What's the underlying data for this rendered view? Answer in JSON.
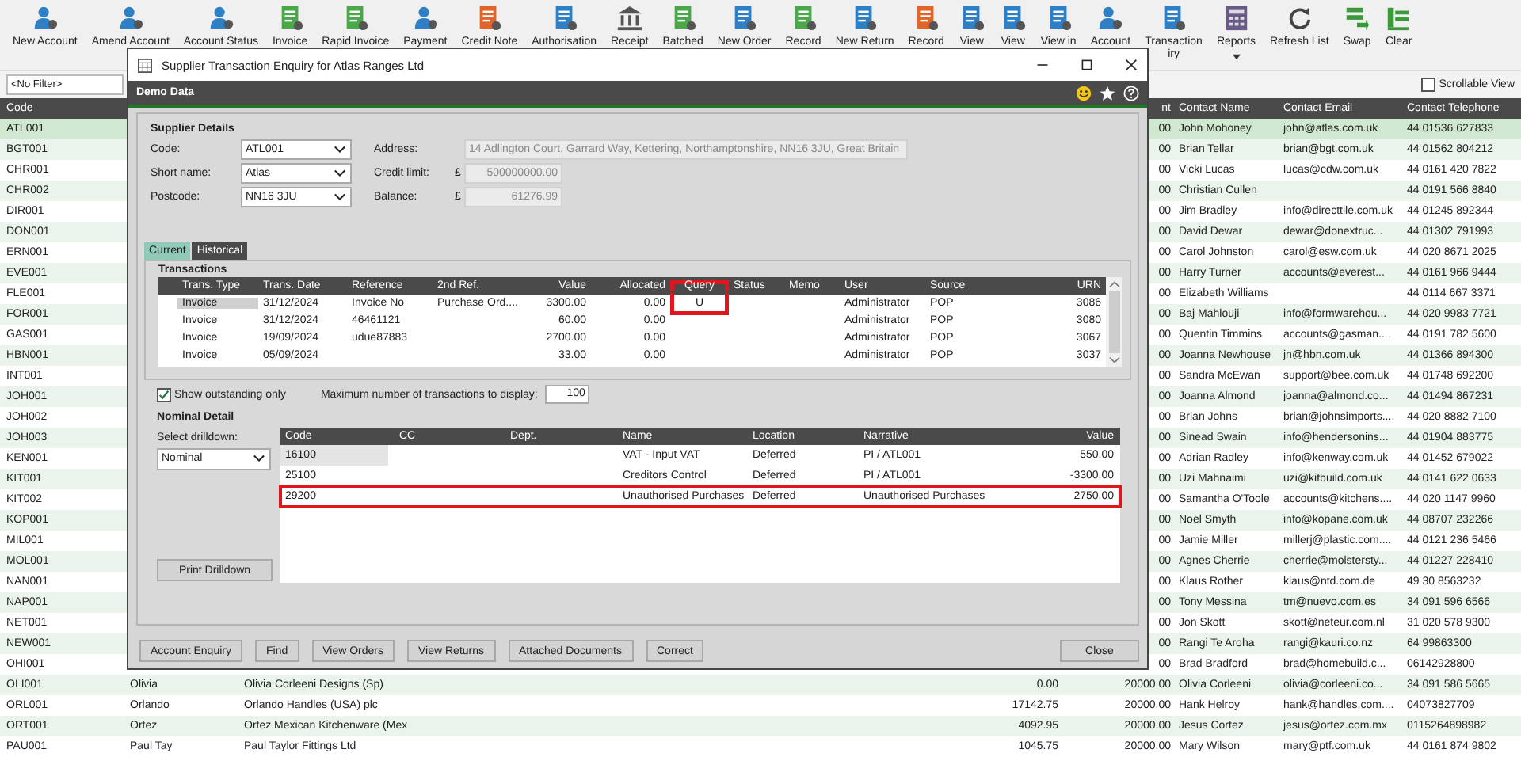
{
  "toolbar": [
    {
      "label": "New Account",
      "dropdown": false
    },
    {
      "label": "Amend Account",
      "dropdown": false
    },
    {
      "label": "Account Status",
      "dropdown": false
    },
    {
      "label": "Invoice",
      "dropdown": false
    },
    {
      "label": "Rapid Invoice",
      "dropdown": false
    },
    {
      "label": "Payment",
      "dropdown": false
    },
    {
      "label": "Credit Note",
      "dropdown": false
    },
    {
      "label": "Authorisation",
      "dropdown": false
    },
    {
      "label": "Receipt",
      "dropdown": false
    },
    {
      "label": "Batched",
      "dropdown": false
    },
    {
      "label": "New Order",
      "dropdown": false
    },
    {
      "label": "Record",
      "dropdown": false
    },
    {
      "label": "New Return",
      "dropdown": false
    },
    {
      "label": "Record",
      "dropdown": false
    },
    {
      "label": "View",
      "dropdown": false
    },
    {
      "label": "View",
      "dropdown": false
    },
    {
      "label": "View in",
      "dropdown": false
    },
    {
      "label": "Account",
      "dropdown": false
    },
    {
      "label": "Transaction",
      "label_2": "iry",
      "dropdown": false
    },
    {
      "label": "Reports",
      "dropdown": true
    },
    {
      "label": "Refresh List",
      "dropdown": false
    },
    {
      "label": "Swap",
      "dropdown": false
    },
    {
      "label": "Clear",
      "dropdown": false
    }
  ],
  "filter": {
    "value": "<No Filter>"
  },
  "scrollable_view": {
    "label": "Scrollable View",
    "checked": false
  },
  "grid": {
    "header": {
      "code": "Code",
      "credit": "nt",
      "contact": "Contact Name",
      "email": "Contact Email",
      "phone": "Contact Telephone"
    },
    "rows": [
      {
        "code": "ATL001",
        "selected": true,
        "credit": "00",
        "contact": "John Mohoney",
        "email": "john@atlas.com.uk",
        "phone": "44 01536 627833"
      },
      {
        "code": "BGT001",
        "selected": false,
        "credit": "00",
        "contact": "Brian Tellar",
        "email": "brian@bgt.com.uk",
        "phone": "44 01562 804212"
      },
      {
        "code": "CHR001",
        "selected": false,
        "credit": "00",
        "contact": "Vicki Lucas",
        "email": "lucas@cdw.com.uk",
        "phone": "44 0161 420 7822"
      },
      {
        "code": "CHR002",
        "selected": false,
        "credit": "00",
        "contact": "Christian Cullen",
        "phone": "44 0191 566 8840"
      },
      {
        "code": "DIR001",
        "selected": false,
        "credit": "00",
        "contact": "Jim Bradley",
        "email": "info@directtile.com.uk",
        "phone": "44 01245 892344"
      },
      {
        "code": "DON001",
        "selected": false,
        "credit": "00",
        "contact": "David Dewar",
        "email": "dewar@donextruc...",
        "phone": "44 01302 791993"
      },
      {
        "code": "ERN001",
        "selected": false,
        "credit": "00",
        "contact": "Carol Johnston",
        "email": "carol@esw.com.uk",
        "phone": "44 020 8671 2025"
      },
      {
        "code": "EVE001",
        "selected": false,
        "credit": "00",
        "contact": "Harry Turner",
        "email": "accounts@everest...",
        "phone": "44 0161 966 9444"
      },
      {
        "code": "FLE001",
        "selected": false,
        "credit": "00",
        "contact": "Elizabeth Williams",
        "phone": "44 0114 667 3371"
      },
      {
        "code": "FOR001",
        "selected": false,
        "credit": "00",
        "contact": "Baj Mahlouji",
        "email": "info@formwarehou...",
        "phone": "44 020 9983 7721"
      },
      {
        "code": "GAS001",
        "selected": false,
        "credit": "00",
        "contact": "Quentin Timmins",
        "email": "accounts@gasman....",
        "phone": "44 0191 782 5600"
      },
      {
        "code": "HBN001",
        "selected": false,
        "credit": "00",
        "contact": "Joanna Newhouse",
        "email": "jn@hbn.com.uk",
        "phone": "44 01366 894300"
      },
      {
        "code": "INT001",
        "selected": false,
        "credit": "00",
        "contact": "Sandra McEwan",
        "email": "support@bee.com.uk",
        "phone": "44 01748 692200"
      },
      {
        "code": "JOH001",
        "selected": false,
        "credit": "00",
        "contact": "Joanna Almond",
        "email": "joanna@almond.co...",
        "phone": "44 01494 867231"
      },
      {
        "code": "JOH002",
        "selected": false,
        "credit": "00",
        "contact": "Brian Johns",
        "email": "brian@johnsimports....",
        "phone": "44 020 8882 7100"
      },
      {
        "code": "JOH003",
        "selected": false,
        "credit": "00",
        "contact": "Sinead Swain",
        "email": "info@hendersonins...",
        "phone": "44 01904 883775"
      },
      {
        "code": "KEN001",
        "selected": false,
        "credit": "00",
        "contact": "Adrian Radley",
        "email": "info@kenway.com.uk",
        "phone": "44 01452 679022"
      },
      {
        "code": "KIT001",
        "selected": false,
        "credit": "00",
        "contact": "Uzi Mahnaimi",
        "email": "uzi@kitbuild.com.uk",
        "phone": "44 0141 622 0633"
      },
      {
        "code": "KIT002",
        "selected": false,
        "credit": "00",
        "contact": "Samantha O'Toole",
        "email": "accounts@kitchens....",
        "phone": "44 020 1147 9960"
      },
      {
        "code": "KOP001",
        "selected": false,
        "credit": "00",
        "contact": "Noel Smyth",
        "email": "info@kopane.com.uk",
        "phone": "44 08707 232266"
      },
      {
        "code": "MIL001",
        "selected": false,
        "credit": "00",
        "contact": "Jamie Miller",
        "email": "millerj@plastic.com....",
        "phone": "44 0121 236 5466"
      },
      {
        "code": "MOL001",
        "selected": false,
        "credit": "00",
        "contact": "Agnes Cherrie",
        "email": "cherrie@molstersty...",
        "phone": "44 01227 228410"
      },
      {
        "code": "NAN001",
        "selected": false,
        "credit": "00",
        "contact": "Klaus Rother",
        "email": "klaus@ntd.com.de",
        "phone": "49 30 8563232"
      },
      {
        "code": "NAP001",
        "selected": false,
        "credit": "00",
        "contact": "Tony Messina",
        "email": "tm@nuevo.com.es",
        "phone": "34 091 596 6566"
      },
      {
        "code": "NET001",
        "selected": false,
        "credit": "00",
        "contact": "Jon Skott",
        "email": "skott@neteur.com.nl",
        "phone": "31 020 578 9300"
      },
      {
        "code": "NEW001",
        "selected": false,
        "credit": "00",
        "contact": "Rangi Te Aroha",
        "email": "rangi@kauri.co.nz",
        "phone": "64 99863300"
      },
      {
        "code": "OHI001",
        "selected": false,
        "credit": "00",
        "contact": "Brad Bradford",
        "email": "brad@homebuild.c...",
        "phone": "06142928800"
      },
      {
        "code": "OLI001",
        "selected": false,
        "short_name": "Olivia",
        "name": "Olivia Corleeni Designs (Sp)",
        "balance": "0.00",
        "credit": "20000.00",
        "contact": "Olivia Corleeni",
        "email": "olivia@corleeni.co...",
        "phone": "34 091 586 5665"
      },
      {
        "code": "ORL001",
        "selected": false,
        "short_name": "Orlando",
        "name": "Orlando Handles (USA) plc",
        "balance": "17142.75",
        "credit": "20000.00",
        "contact": "Hank Helroy",
        "email": "hank@handles.com....",
        "phone": "04073827709"
      },
      {
        "code": "ORT001",
        "selected": false,
        "short_name": "Ortez",
        "name": "Ortez Mexican Kitchenware (Mex",
        "balance": "4092.95",
        "credit": "20000.00",
        "contact": "Jesus Cortez",
        "email": "jesus@ortez.com.mx",
        "phone": "0115264898982"
      },
      {
        "code": "PAU001",
        "selected": false,
        "short_name": "Paul Tay",
        "name": "Paul Taylor Fittings Ltd",
        "balance": "1045.75",
        "credit": "20000.00",
        "contact": "Mary Wilson",
        "email": "mary@ptf.com.uk",
        "phone": "44 0161 874 9802"
      }
    ]
  },
  "dialog": {
    "title": "Supplier Transaction Enquiry for Atlas Ranges Ltd",
    "company": "Demo Data",
    "supplier_details": {
      "title": "Supplier Details",
      "selects": [
        {
          "label": "Code:",
          "value": "ATL001"
        },
        {
          "label": "Short name:",
          "value": "Atlas"
        },
        {
          "label": "Postcode:",
          "value": "NN16 3JU"
        }
      ],
      "info": [
        {
          "label": "Address:",
          "value": "14 Adlington Court, Garrard Way, Kettering, Northamptonshire, NN16 3JU, Great Britain"
        },
        {
          "label": "Credit limit:",
          "currency": "£",
          "value": "500000000.00"
        },
        {
          "label": "Balance:",
          "currency": "£",
          "value": "61276.99"
        }
      ]
    },
    "tabs": [
      {
        "label": "Current",
        "selected": true
      },
      {
        "label": "Historical",
        "selected": false
      }
    ],
    "transactions": {
      "title": "Transactions",
      "columns": [
        {
          "label": "Trans. Type",
          "highlighted": false
        },
        {
          "label": "Trans. Date",
          "highlighted": false
        },
        {
          "label": "Reference",
          "highlighted": false
        },
        {
          "label": "2nd Ref.",
          "highlighted": false
        },
        {
          "label": "Value",
          "highlighted": false
        },
        {
          "label": "Allocated",
          "highlighted": false
        },
        {
          "label": "Query",
          "highlighted": true
        },
        {
          "label": "Status",
          "highlighted": false
        },
        {
          "label": "Memo",
          "highlighted": false
        },
        {
          "label": "User",
          "highlighted": false
        },
        {
          "label": "Source",
          "highlighted": false
        },
        {
          "label": "URN",
          "highlighted": false
        }
      ],
      "rows": [
        {
          "selected": true,
          "type": "Invoice",
          "date": "31/12/2024",
          "reference": "Invoice No",
          "ref2": "Purchase Ord....",
          "value": "3300.00",
          "allocated": "0.00",
          "query": "U",
          "user": "Administrator",
          "source": "POP",
          "urn": "3086"
        },
        {
          "selected": false,
          "type": "Invoice",
          "date": "31/12/2024",
          "reference": "46461121",
          "value": "60.00",
          "allocated": "0.00",
          "user": "Administrator",
          "source": "POP",
          "urn": "3080"
        },
        {
          "selected": false,
          "type": "Invoice",
          "date": "19/09/2024",
          "reference": "udue87883",
          "value": "2700.00",
          "allocated": "0.00",
          "user": "Administrator",
          "source": "POP",
          "urn": "3067"
        },
        {
          "selected": false,
          "type": "Invoice",
          "date": "05/09/2024",
          "value": "33.00",
          "allocated": "0.00",
          "user": "Administrator",
          "source": "POP",
          "urn": "3037"
        }
      ]
    },
    "show_outstanding": {
      "label": "Show outstanding only",
      "checked": true
    },
    "max_transactions": {
      "label": "Maximum number of transactions to display:",
      "value": "100"
    },
    "nominal": {
      "title": "Nominal Detail",
      "drilldown_label": "Select drilldown:",
      "drilldown": "Nominal",
      "print_button": "Print Drilldown",
      "columns": [
        "Code",
        "CC",
        "Dept.",
        "Name",
        "Location",
        "Narrative",
        "Value"
      ],
      "rows": [
        {
          "selected": true,
          "highlighted": false,
          "code": "16100",
          "name": "VAT - Input VAT",
          "location": "Deferred",
          "narrative": "PI / ATL001",
          "value": "550.00"
        },
        {
          "selected": false,
          "highlighted": false,
          "code": "25100",
          "name": "Creditors Control",
          "location": "Deferred",
          "narrative": "PI / ATL001",
          "value": "-3300.00"
        },
        {
          "selected": false,
          "highlighted": true,
          "code": "29200",
          "name": "Unauthorised Purchases",
          "location": "Deferred",
          "narrative": "Unauthorised Purchases",
          "value": "2750.00"
        }
      ]
    },
    "buttons": [
      "Account Enquiry",
      "Find",
      "View Orders",
      "View Returns",
      "Attached Documents",
      "Correct"
    ],
    "close_button": "Close"
  }
}
